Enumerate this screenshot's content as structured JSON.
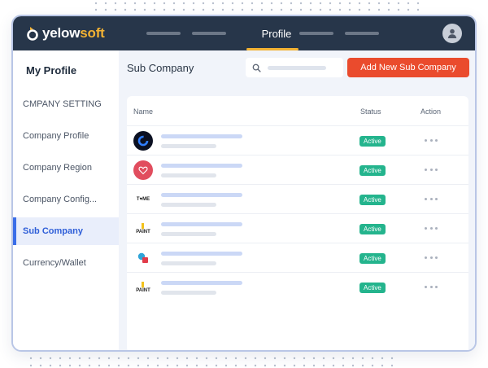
{
  "app": {
    "logo_part1": "yelow",
    "logo_part2": "soft",
    "colors": {
      "topbar": "#27364a",
      "accent": "#f2b233",
      "primary": "#ea4b2d",
      "active_blue": "#3a6ee8",
      "badge": "#24b48d"
    }
  },
  "nav": {
    "active_label": "Profile"
  },
  "sidebar": {
    "title": "My Profile",
    "items": [
      {
        "label": "CMPANY SETTING"
      },
      {
        "label": "Company Profile"
      },
      {
        "label": "Company Region"
      },
      {
        "label": "Company Config..."
      },
      {
        "label": "Sub Company"
      },
      {
        "label": "Currency/Wallet"
      }
    ]
  },
  "main": {
    "title": "Sub Company",
    "add_button_label": "Add New Sub Company",
    "table": {
      "headers": {
        "name": "Name",
        "status": "Status",
        "action": "Action"
      },
      "rows": [
        {
          "status": "Active",
          "logo": "ring-logo",
          "logo_text": ""
        },
        {
          "status": "Active",
          "logo": "heart-logo",
          "logo_text": ""
        },
        {
          "status": "Active",
          "logo": "text-logo",
          "logo_text": "T♥ME"
        },
        {
          "status": "Active",
          "logo": "paint-logo",
          "logo_text": "PAINT"
        },
        {
          "status": "Active",
          "logo": "shapes-logo",
          "logo_text": ""
        },
        {
          "status": "Active",
          "logo": "paint-logo",
          "logo_text": "PAINT"
        }
      ]
    }
  }
}
